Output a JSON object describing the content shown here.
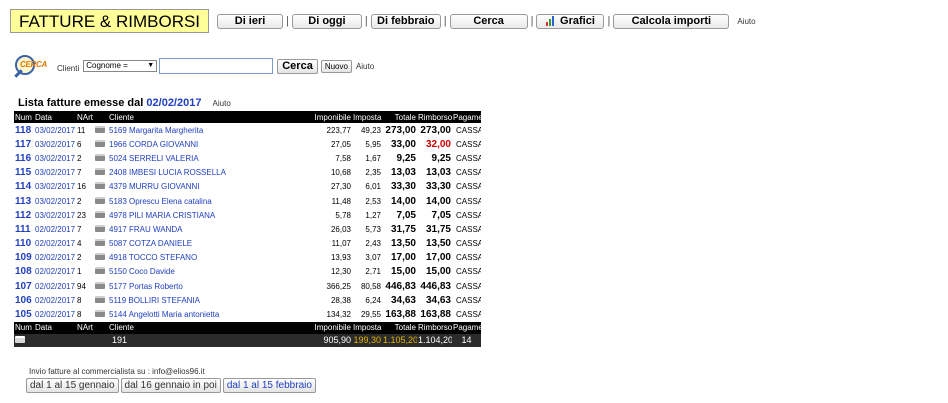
{
  "header": {
    "title": "FATTURE & RIMBORSI",
    "nav": [
      {
        "label": "Di ieri",
        "name": "di-ieri-button"
      },
      {
        "label": "Di oggi",
        "name": "di-oggi-button"
      },
      {
        "label": "Di febbraio",
        "name": "di-febbraio-button"
      },
      {
        "label": "Cerca",
        "name": "cerca-nav-button"
      },
      {
        "label": "Grafici",
        "name": "grafici-button"
      },
      {
        "label": "Calcola importi",
        "name": "calcola-importi-button"
      }
    ],
    "help": "Aiuto"
  },
  "search": {
    "logo_text": "CERCA",
    "label": "Clienti",
    "field_selected": "Cognome =",
    "input_value": "",
    "search_button": "Cerca",
    "new_button": "Nuovo",
    "help": "Aiuto"
  },
  "list": {
    "title_prefix": "Lista fatture emesse dal",
    "title_date": "02/02/2017",
    "help": "Aiuto",
    "columns": [
      "Num",
      "Data",
      "NArt",
      "",
      "Cliente",
      "Imponibile",
      "Imposta",
      "Totale",
      "Rimborso",
      "Pagamento"
    ],
    "rows": [
      {
        "num": "118",
        "data": "03/02/2017",
        "nart": "11",
        "cliente": "5169 Margarita Margherita",
        "imponibile": "223,77",
        "imposta": "49,23",
        "totale": "273,00",
        "rimborso": "273,00",
        "pagamento": "CASSA",
        "rimborso_red": false
      },
      {
        "num": "117",
        "data": "03/02/2017",
        "nart": "6",
        "cliente": "1966 CORDA GIOVANNI",
        "imponibile": "27,05",
        "imposta": "5,95",
        "totale": "33,00",
        "rimborso": "32,00",
        "pagamento": "CASSA",
        "rimborso_red": true
      },
      {
        "num": "116",
        "data": "03/02/2017",
        "nart": "2",
        "cliente": "5024 SERRELI VALERIA",
        "imponibile": "7,58",
        "imposta": "1,67",
        "totale": "9,25",
        "rimborso": "9,25",
        "pagamento": "CASSA",
        "rimborso_red": false
      },
      {
        "num": "115",
        "data": "03/02/2017",
        "nart": "7",
        "cliente": "2408 IMBESI LUCIA ROSSELLA",
        "imponibile": "10,68",
        "imposta": "2,35",
        "totale": "13,03",
        "rimborso": "13,03",
        "pagamento": "CASSA",
        "rimborso_red": false
      },
      {
        "num": "114",
        "data": "03/02/2017",
        "nart": "16",
        "cliente": "4379 MURRU GIOVANNI",
        "imponibile": "27,30",
        "imposta": "6,01",
        "totale": "33,30",
        "rimborso": "33,30",
        "pagamento": "CASSA",
        "rimborso_red": false
      },
      {
        "num": "113",
        "data": "03/02/2017",
        "nart": "2",
        "cliente": "5183 Oprescu Elena catalina",
        "imponibile": "11,48",
        "imposta": "2,53",
        "totale": "14,00",
        "rimborso": "14,00",
        "pagamento": "CASSA",
        "rimborso_red": false
      },
      {
        "num": "112",
        "data": "03/02/2017",
        "nart": "23",
        "cliente": "4978 PILI MARIA CRISTIANA",
        "imponibile": "5,78",
        "imposta": "1,27",
        "totale": "7,05",
        "rimborso": "7,05",
        "pagamento": "CASSA",
        "rimborso_red": false
      },
      {
        "num": "111",
        "data": "02/02/2017",
        "nart": "7",
        "cliente": "4917 FRAU WANDA",
        "imponibile": "26,03",
        "imposta": "5,73",
        "totale": "31,75",
        "rimborso": "31,75",
        "pagamento": "CASSA",
        "rimborso_red": false
      },
      {
        "num": "110",
        "data": "02/02/2017",
        "nart": "4",
        "cliente": "5087 COTZA DANIELE",
        "imponibile": "11,07",
        "imposta": "2,43",
        "totale": "13,50",
        "rimborso": "13,50",
        "pagamento": "CASSA",
        "rimborso_red": false
      },
      {
        "num": "109",
        "data": "02/02/2017",
        "nart": "2",
        "cliente": "4918 TOCCO STEFANO",
        "imponibile": "13,93",
        "imposta": "3,07",
        "totale": "17,00",
        "rimborso": "17,00",
        "pagamento": "CASSA",
        "rimborso_red": false
      },
      {
        "num": "108",
        "data": "02/02/2017",
        "nart": "1",
        "cliente": "5150 Coco Davide",
        "imponibile": "12,30",
        "imposta": "2,71",
        "totale": "15,00",
        "rimborso": "15,00",
        "pagamento": "CASSA",
        "rimborso_red": false
      },
      {
        "num": "107",
        "data": "02/02/2017",
        "nart": "94",
        "cliente": "5177 Portas Roberto",
        "imponibile": "366,25",
        "imposta": "80,58",
        "totale": "446,83",
        "rimborso": "446,83",
        "pagamento": "CASSA",
        "rimborso_red": false
      },
      {
        "num": "106",
        "data": "02/02/2017",
        "nart": "8",
        "cliente": "5119 BOLLIRI STEFANIA",
        "imponibile": "28,38",
        "imposta": "6,24",
        "totale": "34,63",
        "rimborso": "34,63",
        "pagamento": "CASSA",
        "rimborso_red": false
      },
      {
        "num": "105",
        "data": "02/02/2017",
        "nart": "8",
        "cliente": "5144 Angelotti Maria antonietta",
        "imponibile": "134,32",
        "imposta": "29,55",
        "totale": "163,88",
        "rimborso": "163,88",
        "pagamento": "CASSA",
        "rimborso_red": false
      }
    ],
    "totals": {
      "nart": "191",
      "imponibile": "905,90",
      "imposta": "199,30",
      "totale": "1.105,20",
      "rimborso": "1.104,20",
      "pagamento": "14"
    }
  },
  "footer": {
    "mail_note": "Invio fatture al commercialista su : info@elios96.it",
    "period_buttons": [
      {
        "label": "dal 1 al 15 gennaio",
        "active": false
      },
      {
        "label": "dal 16 gennaio in poi",
        "active": false
      },
      {
        "label": "dal 1 al 15 febbraio",
        "active": true
      }
    ]
  },
  "colors": {
    "title_bg": "#ffff99",
    "link_blue": "#2040c0",
    "alert_red": "#d00000",
    "total_yellow": "#e3b300",
    "header_black": "#000000"
  }
}
